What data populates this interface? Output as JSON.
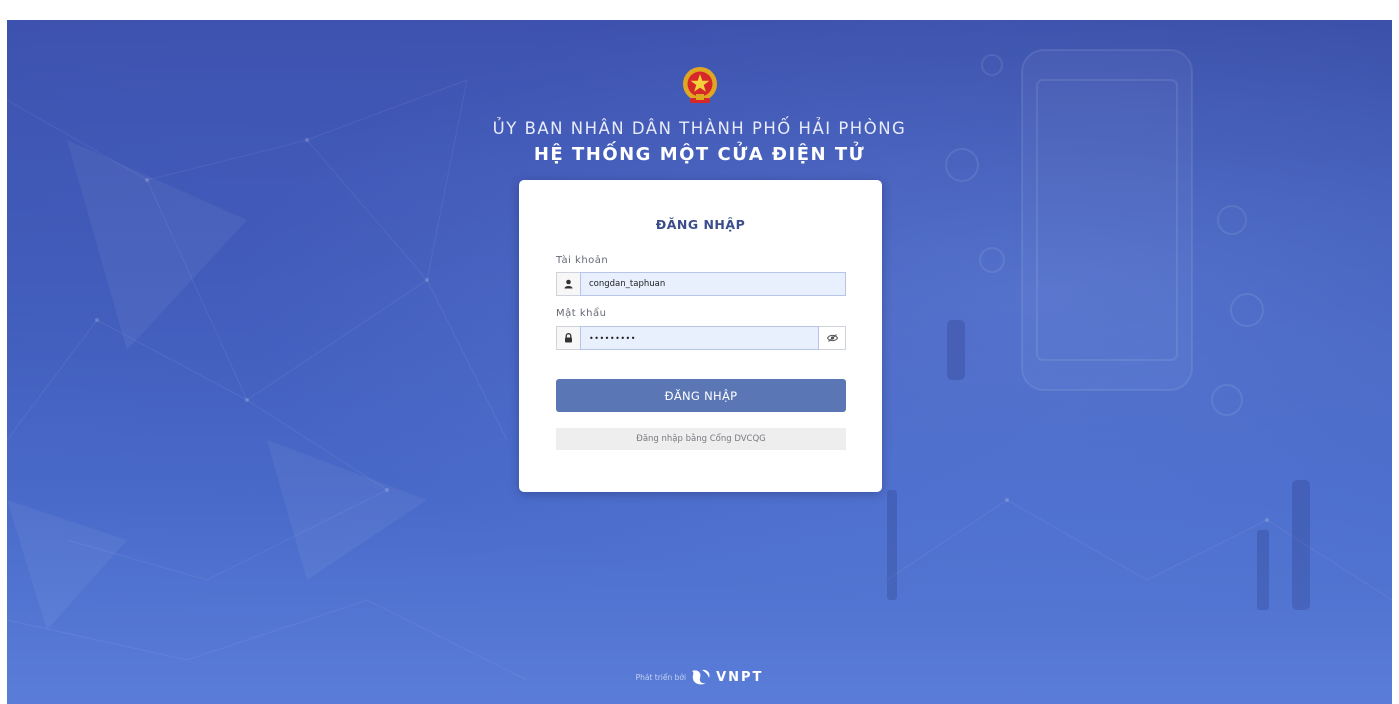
{
  "header": {
    "organization": "ỦY BAN NHÂN DÂN THÀNH PHỐ HẢI PHÒNG",
    "system_title": "HỆ THỐNG MỘT CỬA ĐIỆN TỬ",
    "emblem_icon": "national-emblem-icon"
  },
  "login": {
    "title": "ĐĂNG NHẬP",
    "username_label": "Tài khoản",
    "username_value": "congdan_taphuan",
    "username_icon": "user-icon",
    "password_label": "Mật khẩu",
    "password_value": "•••••••••",
    "password_icon": "lock-icon",
    "show_password_icon": "eye-icon",
    "submit_label": "ĐĂNG NHẬP",
    "alt_login_label": "Đăng nhập bằng Cổng DVCQG"
  },
  "footer": {
    "developed_by": "Phát triển bởi",
    "brand": "VNPT"
  },
  "colors": {
    "background_top": "#3a4fa8",
    "background_bottom": "#5a7dd8",
    "primary_button": "#5b76b4",
    "title_text": "#3c4d8c",
    "input_fill": "#e8f0fe"
  }
}
